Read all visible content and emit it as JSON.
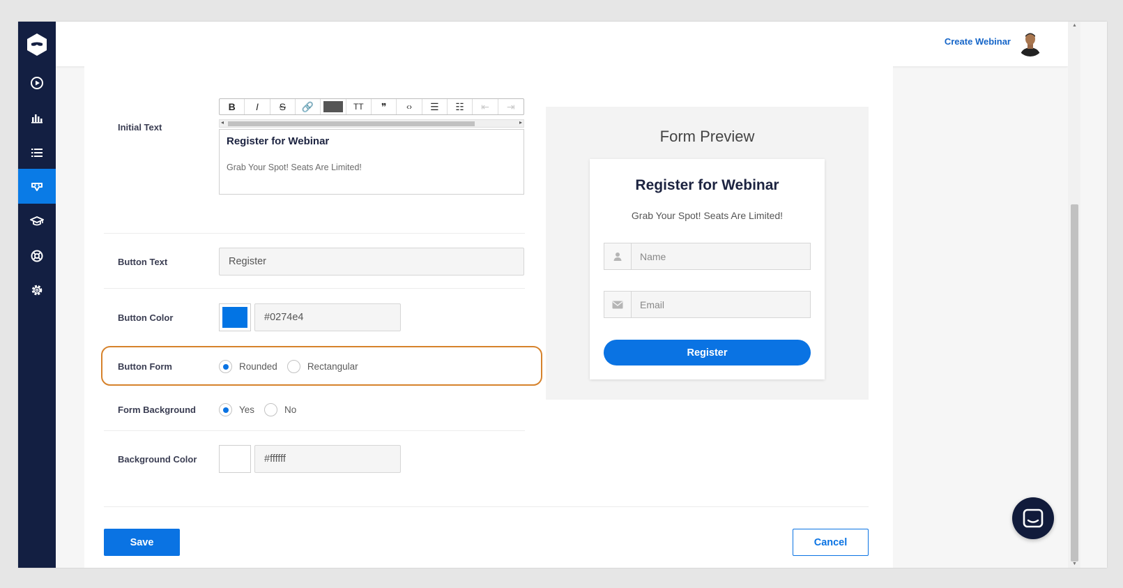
{
  "header": {
    "create_label": "Create Webinar"
  },
  "sidebar": {
    "items": [
      {
        "icon": "play-circle-icon"
      },
      {
        "icon": "bar-chart-icon"
      },
      {
        "icon": "list-icon"
      },
      {
        "icon": "webinar-mask-icon",
        "active": true
      },
      {
        "icon": "graduation-cap-icon"
      },
      {
        "icon": "lifebuoy-icon"
      },
      {
        "icon": "gear-icon"
      }
    ]
  },
  "form": {
    "initial_text_label": "Initial Text",
    "toolbar_buttons": [
      {
        "glyph": "B",
        "icon": "bold-icon"
      },
      {
        "glyph": "I",
        "icon": "italic-icon"
      },
      {
        "glyph": "S",
        "icon": "strikethrough-icon"
      },
      {
        "glyph": "🔗",
        "icon": "link-icon"
      },
      {
        "glyph": "",
        "icon": "text-color-icon"
      },
      {
        "glyph": "TT",
        "icon": "font-size-icon"
      },
      {
        "glyph": "❞",
        "icon": "quote-icon"
      },
      {
        "glyph": "‹›",
        "icon": "code-icon"
      },
      {
        "glyph": "☰",
        "icon": "bullet-list-icon"
      },
      {
        "glyph": "☷",
        "icon": "numbered-list-icon"
      },
      {
        "glyph": "⇤",
        "icon": "outdent-icon"
      },
      {
        "glyph": "⇥",
        "icon": "indent-icon"
      }
    ],
    "editor_title": "Register for Webinar",
    "editor_subtitle": "Grab Your Spot! Seats Are Limited!",
    "button_text_label": "Button Text",
    "button_text_value": "Register",
    "button_color_label": "Button Color",
    "button_color_value": "#0274e4",
    "button_form_label": "Button Form",
    "button_form_options": {
      "rounded": "Rounded",
      "rectangular": "Rectangular"
    },
    "button_form_selected": "rounded",
    "form_background_label": "Form Background",
    "form_background_options": {
      "yes": "Yes",
      "no": "No"
    },
    "form_background_selected": "yes",
    "background_color_label": "Background Color",
    "background_color_value": "#ffffff"
  },
  "preview": {
    "title": "Form Preview",
    "card_title": "Register for Webinar",
    "card_subtitle": "Grab Your Spot! Seats Are Limited!",
    "name_placeholder": "Name",
    "email_placeholder": "Email",
    "button_label": "Register"
  },
  "actions": {
    "save_label": "Save",
    "cancel_label": "Cancel"
  },
  "colors": {
    "accent": "#0a73e3",
    "sidebar": "#131f42",
    "highlight": "#d6822b"
  }
}
